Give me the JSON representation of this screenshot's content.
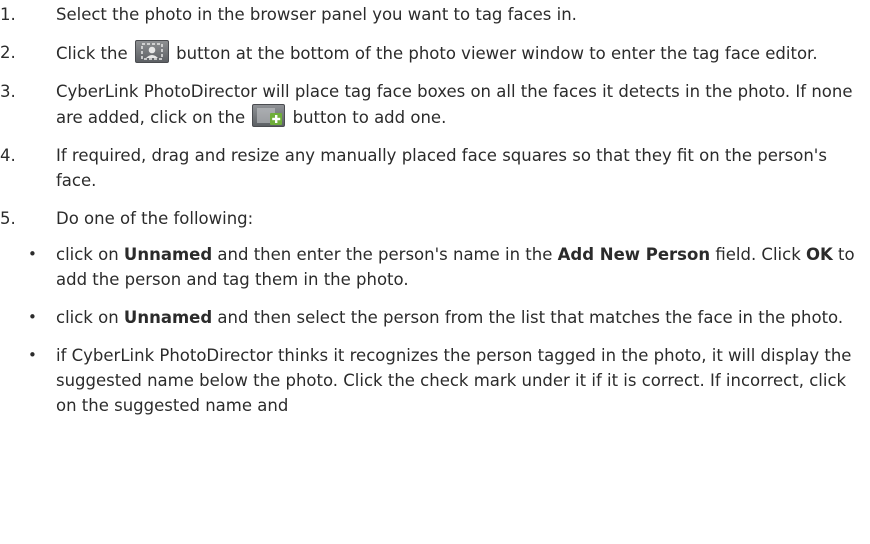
{
  "steps": [
    {
      "num": "1.",
      "text": "Select the photo in the browser panel you want to tag faces in."
    },
    {
      "num": "2.",
      "before": "Click the",
      "after": "button at the bottom of the photo viewer window to enter the tag face editor.",
      "icon": "tag-face-button-icon"
    },
    {
      "num": "3.",
      "before": "CyberLink PhotoDirector will place tag face boxes on all the faces it detects in the photo. If none are added, click on the",
      "after": "button to add one.",
      "icon": "add-face-box-icon"
    },
    {
      "num": "4.",
      "text": "If required, drag and resize any manually placed face squares so that they fit on the person's face."
    },
    {
      "num": "5.",
      "text": "Do one of the following:"
    }
  ],
  "bullets": [
    {
      "p1": "click on ",
      "b1": "Unnamed",
      "p2": " and then enter the person's name in the ",
      "b2": "Add New Person",
      "p3": " field. Click ",
      "b3": "OK",
      "p4": " to add the person and tag them in the photo."
    },
    {
      "p1": "click on ",
      "b1": "Unnamed",
      "p2": " and then select the person from the list that matches the face in the photo."
    },
    {
      "p1": "if CyberLink PhotoDirector thinks it recognizes the person tagged in the photo, it will display the suggested name below the photo. Click the check mark under it if it is correct. If incorrect, click on the suggested name and"
    }
  ],
  "bullet_char": "•"
}
